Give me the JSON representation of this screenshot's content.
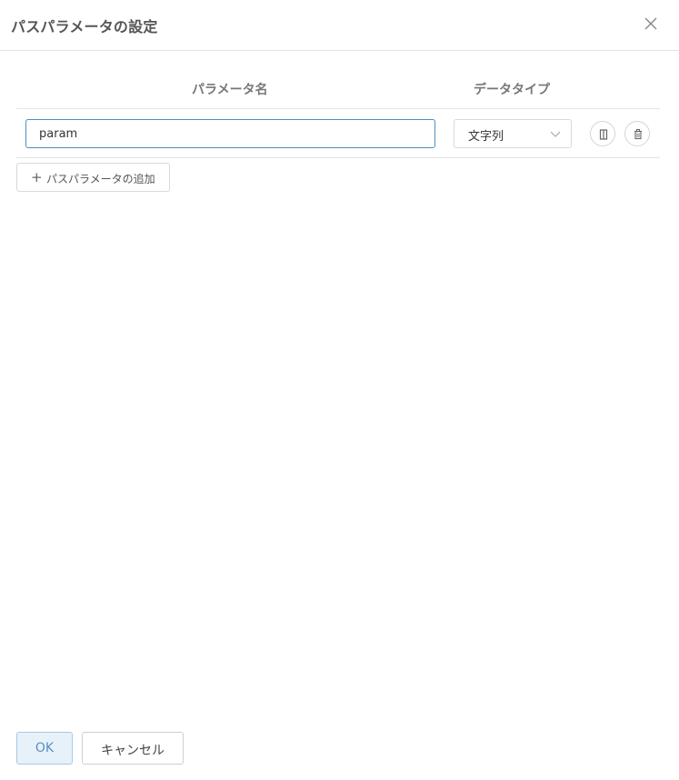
{
  "dialog": {
    "title": "パスパラメータの設定"
  },
  "table": {
    "headers": {
      "name": "パラメータ名",
      "type": "データタイプ"
    },
    "rows": [
      {
        "name_value": "param",
        "type_value": "文字列"
      }
    ]
  },
  "actions": {
    "add_label": "パスパラメータの追加",
    "add_icon": "+",
    "ok_label": "OK",
    "cancel_label": "キャンセル"
  },
  "icons": {
    "close": "close-icon",
    "dropdown": "chevron-down-icon",
    "copy": "copy-icon",
    "delete": "trash-icon"
  },
  "colors": {
    "focus_border": "#4a90c2",
    "primary_bg": "#e7f1fa",
    "primary_text": "#5a8fbe"
  }
}
